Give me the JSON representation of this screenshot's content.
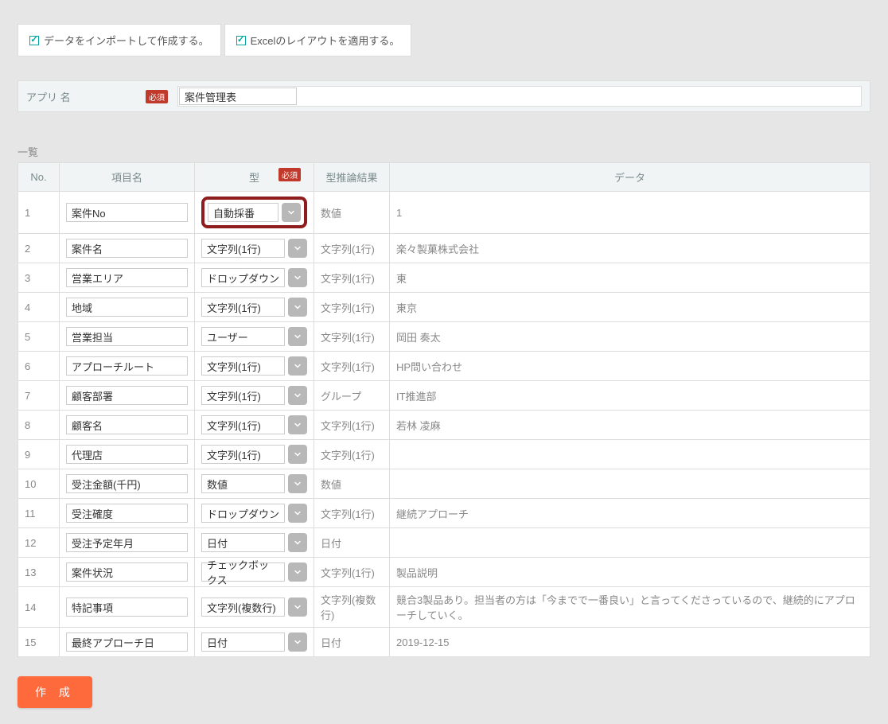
{
  "top": {
    "import_label": "データをインポートして作成する。",
    "layout_label": "Excelのレイアウトを適用する。"
  },
  "appname": {
    "label": "アプリ 名",
    "required": "必須",
    "value": "案件管理表"
  },
  "list_heading": "一覧",
  "headers": {
    "no": "No.",
    "name": "項目名",
    "type": "型",
    "required": "必須",
    "inference": "型推論結果",
    "data": "データ"
  },
  "rows": [
    {
      "no": "1",
      "name": "案件No",
      "type": "自動採番",
      "inference": "数値",
      "data": "1"
    },
    {
      "no": "2",
      "name": "案件名",
      "type": "文字列(1行)",
      "inference": "文字列(1行)",
      "data": "楽々製菓株式会社"
    },
    {
      "no": "3",
      "name": "営業エリア",
      "type": "ドロップダウン",
      "inference": "文字列(1行)",
      "data": "東"
    },
    {
      "no": "4",
      "name": "地域",
      "type": "文字列(1行)",
      "inference": "文字列(1行)",
      "data": "東京"
    },
    {
      "no": "5",
      "name": "営業担当",
      "type": "ユーザー",
      "inference": "文字列(1行)",
      "data": "岡田 奏太"
    },
    {
      "no": "6",
      "name": "アプローチルート",
      "type": "文字列(1行)",
      "inference": "文字列(1行)",
      "data": "HP問い合わせ"
    },
    {
      "no": "7",
      "name": "顧客部署",
      "type": "文字列(1行)",
      "inference": "グループ",
      "data": "IT推進部"
    },
    {
      "no": "8",
      "name": "顧客名",
      "type": "文字列(1行)",
      "inference": "文字列(1行)",
      "data": "若林 凌麻"
    },
    {
      "no": "9",
      "name": "代理店",
      "type": "文字列(1行)",
      "inference": "文字列(1行)",
      "data": ""
    },
    {
      "no": "10",
      "name": "受注金額(千円)",
      "type": "数値",
      "inference": "数値",
      "data": ""
    },
    {
      "no": "11",
      "name": "受注確度",
      "type": "ドロップダウン",
      "inference": "文字列(1行)",
      "data": "継続アプローチ"
    },
    {
      "no": "12",
      "name": "受注予定年月",
      "type": "日付",
      "inference": "日付",
      "data": ""
    },
    {
      "no": "13",
      "name": "案件状況",
      "type": "チェックボックス",
      "inference": "文字列(1行)",
      "data": "製品説明"
    },
    {
      "no": "14",
      "name": "特記事項",
      "type": "文字列(複数行)",
      "inference": "文字列(複数行)",
      "data": "競合3製品あり。担当者の方は「今までで一番良い」と言ってくださっているので、継続的にアプローチしていく。"
    },
    {
      "no": "15",
      "name": "最終アプローチ日",
      "type": "日付",
      "inference": "日付",
      "data": "2019-12-15"
    }
  ],
  "button": {
    "create": "作 成"
  }
}
